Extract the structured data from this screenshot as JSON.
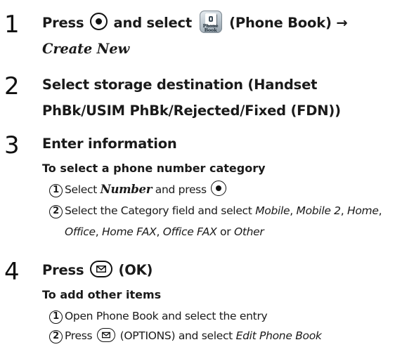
{
  "steps": [
    {
      "number": "1",
      "press": "Press",
      "and_select": "and select",
      "app_icon_label": "Phone Book",
      "app_paren": "(Phone Book)",
      "arrow": "→",
      "target": "Create New",
      "center_key_icon": "center-key-icon",
      "app_icon": "phone-book-app-icon"
    },
    {
      "number": "2",
      "text": "Select storage destination (Handset PhBk/USIM PhBk/Rejected/Fixed (FDN))"
    },
    {
      "number": "3",
      "text": "Enter information",
      "subsection": {
        "title": "To select a phone number category",
        "items": [
          {
            "marker": "1",
            "pre": "Select",
            "bold_italic": "Number",
            "post": "and press"
          },
          {
            "marker": "2",
            "pre": "Select the Category field and select",
            "options": [
              "Mobile",
              "Mobile 2",
              "Home",
              "Office",
              "Home FAX",
              "Office FAX"
            ],
            "or_word": "or",
            "last_option": "Other"
          }
        ]
      }
    },
    {
      "number": "4",
      "press": "Press",
      "suffix": "(OK)",
      "mail_key_icon": "mail-key-icon",
      "subsection": {
        "title": "To add other items",
        "items": [
          {
            "marker": "1",
            "text": "Open Phone Book and select the entry"
          },
          {
            "marker": "2",
            "pre": "Press",
            "mid": "(OPTIONS) and select",
            "italic": "Edit Phone Book"
          }
        ]
      }
    }
  ]
}
